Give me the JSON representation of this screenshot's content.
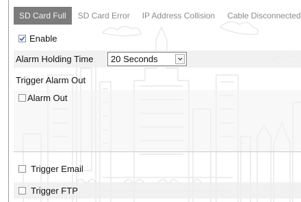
{
  "tabs": [
    {
      "label": "SD Card Full",
      "active": true
    },
    {
      "label": "SD Card Error",
      "active": false
    },
    {
      "label": "IP Address Collision",
      "active": false
    },
    {
      "label": "Cable Disconnected",
      "active": false
    }
  ],
  "enable": {
    "label": "Enable",
    "checked": true
  },
  "alarm_holding_time": {
    "label": "Alarm Holding Time",
    "value": "20 Seconds"
  },
  "trigger_alarm_out": {
    "title": "Trigger Alarm Out",
    "alarm_out": {
      "label": "Alarm Out",
      "checked": false
    }
  },
  "trigger_email": {
    "label": "Trigger Email",
    "checked": false
  },
  "trigger_ftp": {
    "label": "Trigger FTP",
    "checked": false
  },
  "colors": {
    "active_tab_bg": "#7c7c7c",
    "tab_text": "#8a8a8a",
    "check_blue": "#2d5fb5"
  }
}
